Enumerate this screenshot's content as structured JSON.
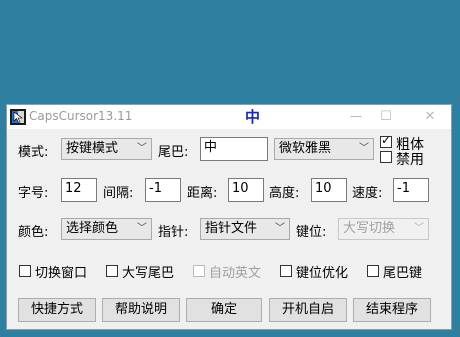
{
  "window": {
    "title": "CapsCursor13.11",
    "center_char": "中",
    "minimize": "—",
    "maximize": "☐",
    "close": "✕"
  },
  "row1": {
    "mode_label": "模式:",
    "mode_value": "按键模式",
    "tail_label": "尾巴:",
    "tail_value": "中",
    "font_value": "微软雅黑",
    "bold_label": "粗体",
    "disable_label": "禁用"
  },
  "row2": {
    "font_size_label": "字号:",
    "font_size_value": "12",
    "spacing_label": "间隔:",
    "spacing_value": "-1",
    "distance_label": "距离:",
    "distance_value": "10",
    "height_label": "高度:",
    "height_value": "10",
    "speed_label": "速度:",
    "speed_value": "-1"
  },
  "row3": {
    "color_label": "颜色:",
    "color_value": "选择颜色",
    "pointer_label": "指针:",
    "pointer_value": "指针文件",
    "keypos_label": "键位:",
    "keypos_value": "大写切换"
  },
  "row4": {
    "switch_window": "切换窗口",
    "caps_tail": "大写尾巴",
    "auto_english": "自动英文",
    "keypos_opt": "键位优化",
    "tail_key": "尾巴键"
  },
  "buttons": {
    "shortcut": "快捷方式",
    "help": "帮助说明",
    "ok": "确定",
    "autostart": "开机自启",
    "exit": "结束程序"
  },
  "colors": {
    "desktop": "#2f7fa0",
    "center_char": "#1b2aa8"
  }
}
